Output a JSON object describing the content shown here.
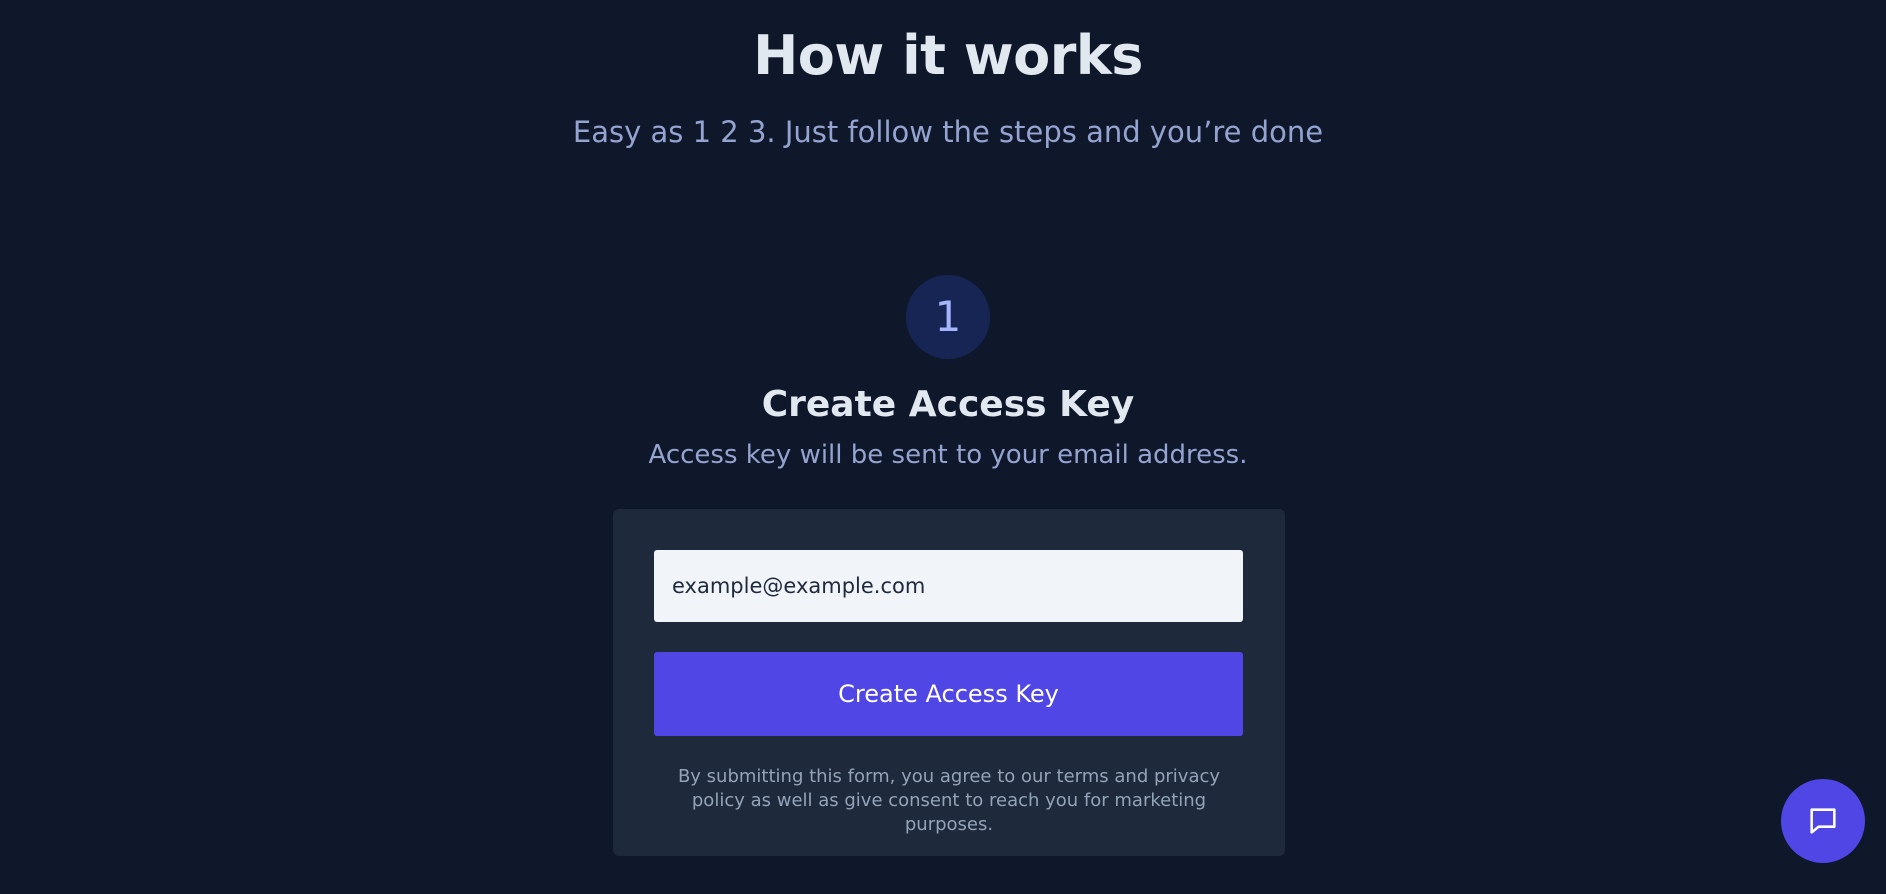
{
  "header": {
    "title": "How it works",
    "subtitle": "Easy as 1 2 3. Just follow the steps and you’re done"
  },
  "step": {
    "number": "1",
    "title": "Create Access Key",
    "description": "Access key will be sent to your email address."
  },
  "form": {
    "email_value": "example@example.com",
    "submit_label": "Create Access Key",
    "disclaimer": "By submitting this form, you agree to our terms and privacy policy as well as give consent to reach you for marketing purposes."
  },
  "chat": {
    "icon": "chat-bubble-icon"
  },
  "colors": {
    "background": "#0f172a",
    "card": "#1e293b",
    "accent": "#4f46e5",
    "step_circle": "#172554"
  }
}
